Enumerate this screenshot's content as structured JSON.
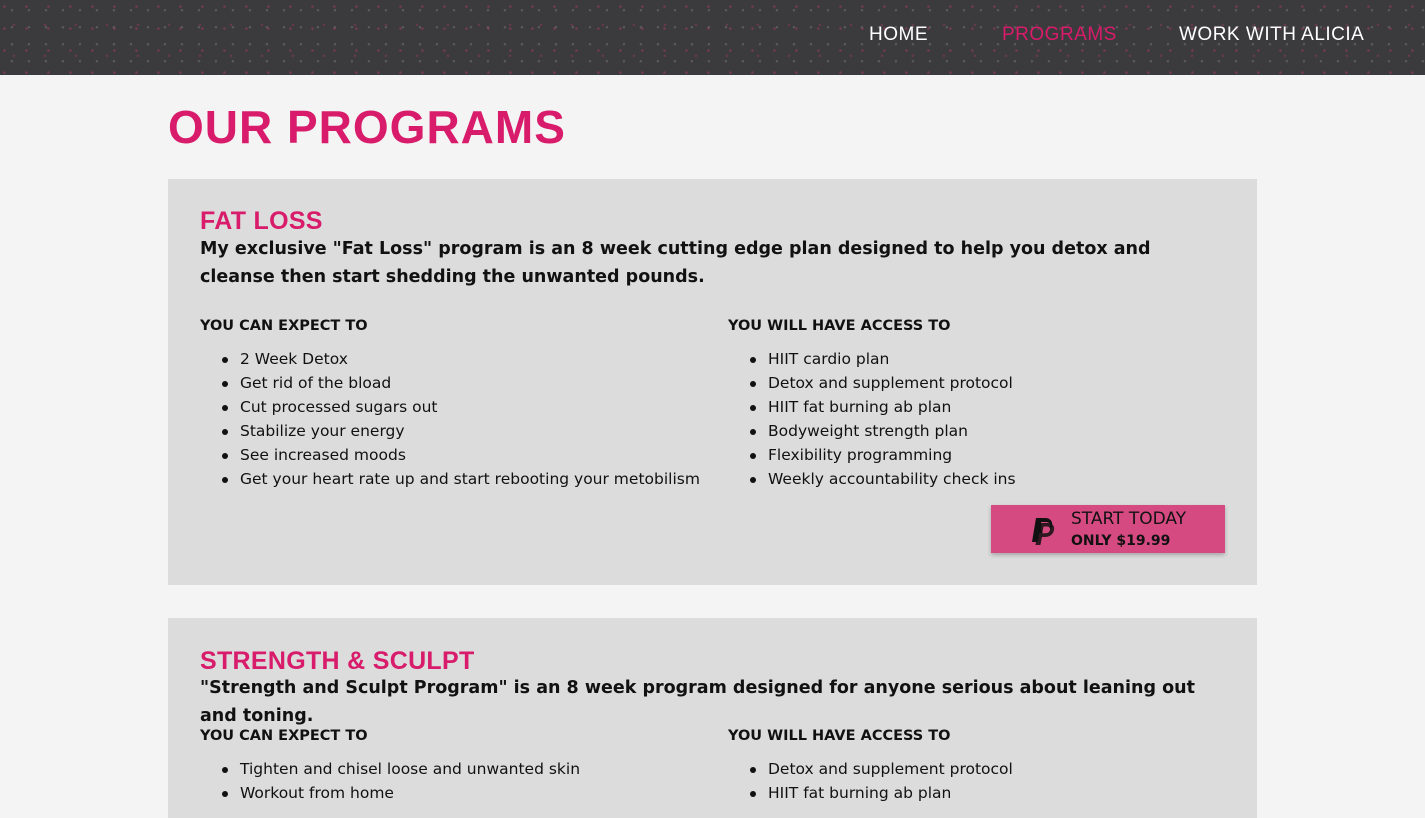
{
  "nav": {
    "home": "HOME",
    "programs": "PROGRAMS",
    "work": "WORK WITH ALICIA",
    "active": "PROGRAMS"
  },
  "page": {
    "title": "OUR PROGRAMS"
  },
  "colors": {
    "accent": "#d81b6a",
    "button": "#d64a82",
    "nav_bg": "#3b3a3d",
    "card_bg": "#dcdcdc",
    "page_bg": "#f4f4f4"
  },
  "programs": [
    {
      "title": "FAT LOSS",
      "description": "My exclusive \"Fat Loss\" program is an 8 week cutting edge plan designed to help you detox and cleanse then start shedding the unwanted pounds.",
      "expect_heading": "YOU CAN EXPECT TO",
      "expect": [
        "2 Week Detox",
        "Get rid of the bload",
        "Cut processed sugars out",
        "Stabilize your energy",
        "See increased moods",
        "Get your heart rate up and start rebooting your metobilism"
      ],
      "access_heading": "YOU WILL HAVE ACCESS TO",
      "access": [
        "HIIT cardio plan",
        "Detox and supplement protocol",
        "HIIT fat burning ab plan",
        "Bodyweight strength plan",
        "Flexibility programming",
        "Weekly accountability check ins"
      ],
      "cta": {
        "icon": "paypal-icon",
        "label": "START TODAY",
        "price": "ONLY $19.99"
      }
    },
    {
      "title": "STRENGTH & SCULPT",
      "description": "\"Strength and Sculpt Program\" is an 8 week program designed for anyone serious about leaning out and toning.",
      "expect_heading": "YOU CAN EXPECT TO",
      "expect": [
        "Tighten and chisel loose and unwanted skin",
        "Workout from home"
      ],
      "access_heading": "YOU WILL HAVE ACCESS TO",
      "access": [
        "Detox and supplement protocol",
        "HIIT fat burning ab plan"
      ]
    }
  ]
}
